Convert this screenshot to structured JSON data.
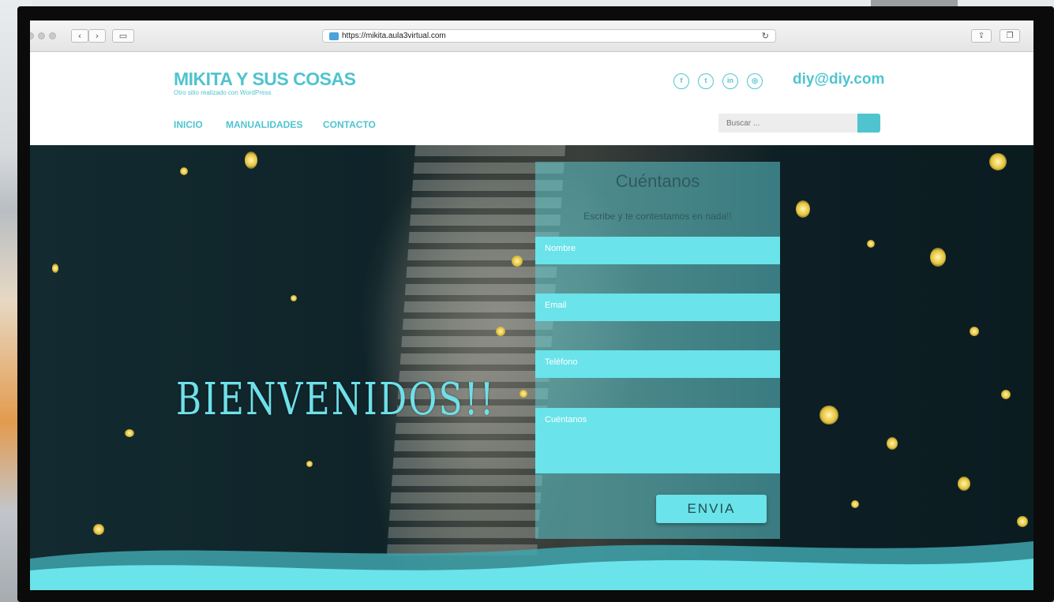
{
  "browser": {
    "url": "https://mikita.aula3virtual.com"
  },
  "site": {
    "title": "MIKITA Y SUS COSAS",
    "tagline": "Otro sitio realizado con WordPress",
    "email": "diy@diy.com",
    "social": [
      {
        "icon": "facebook-icon",
        "glyph": "f"
      },
      {
        "icon": "twitter-icon",
        "glyph": "t"
      },
      {
        "icon": "linkedin-icon",
        "glyph": "in"
      },
      {
        "icon": "instagram-icon",
        "glyph": "◎"
      }
    ],
    "nav": [
      "INICIO",
      "MANUALIDADES",
      "CONTACTO"
    ],
    "search_placeholder": "Buscar ..."
  },
  "hero": {
    "welcome": "BIENVENIDOS!!"
  },
  "form": {
    "title": "Cuéntanos",
    "subtitle": "Escribe y te contestamos en nada!!",
    "name_placeholder": "Nombre",
    "email_placeholder": "Email",
    "phone_placeholder": "Teléfono",
    "message_placeholder": "Cuéntanos",
    "submit_label": "ENVIA"
  },
  "colors": {
    "accent": "#4fc4cf",
    "field": "#6ae3ea",
    "hero_dark": "#0f2429"
  }
}
